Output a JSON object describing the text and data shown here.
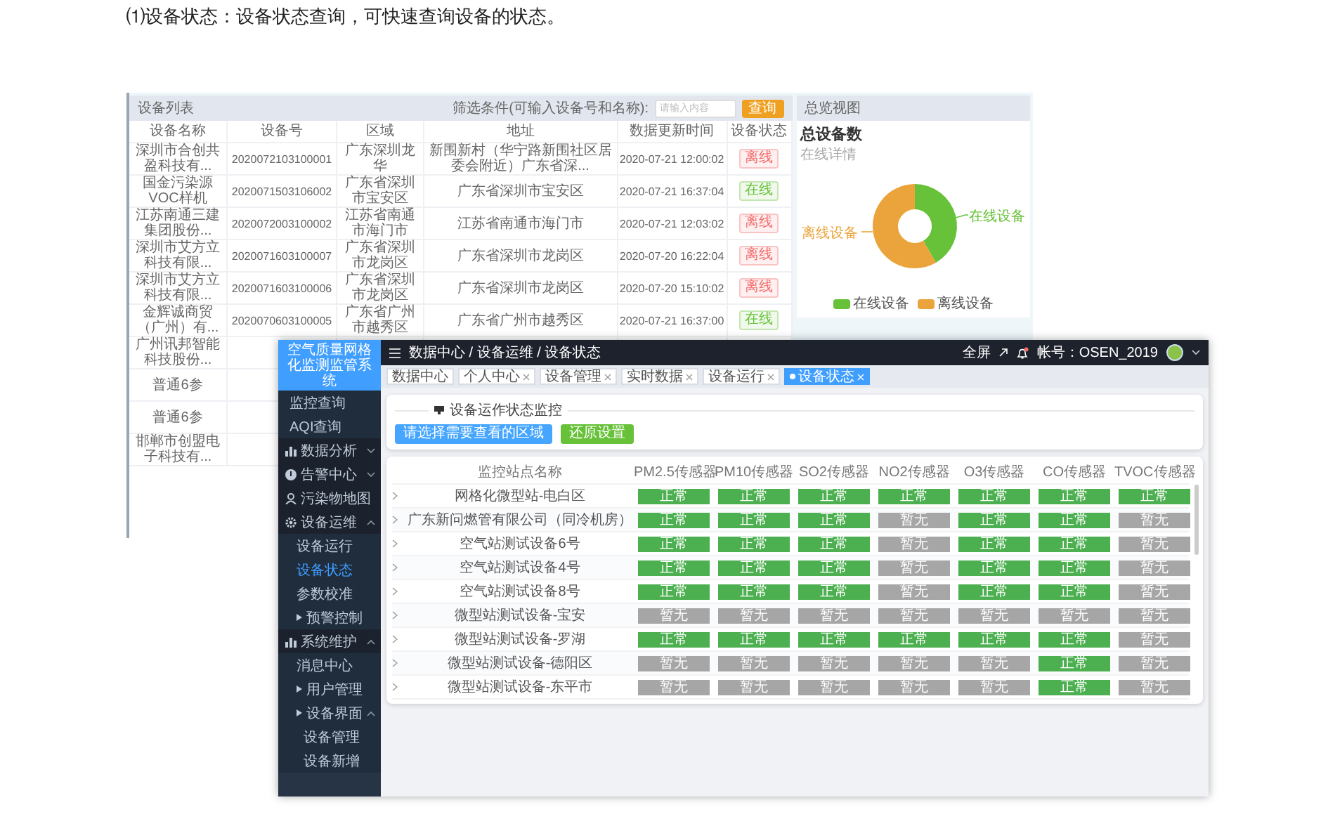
{
  "caption": "⑴设备状态：设备状态查询，可快速查询设备的状态。",
  "back_window": {
    "list_panel": {
      "title": "设备列表",
      "filter_label": "筛选条件(可输入设备号和名称):",
      "search": {
        "placeholder": "请输入内容"
      },
      "query_button": "查询",
      "columns": [
        "设备名称",
        "设备号",
        "区域",
        "地址",
        "数据更新时间",
        "设备状态"
      ],
      "rows": [
        {
          "name": "深圳市合创共盈科技有...",
          "number": "2020072103100001",
          "region": "广东深圳龙华",
          "address": "新围新村（华宁路新围社区居委会附近）广东省深...",
          "updated": "2020-07-21 12:00:02",
          "status": {
            "label": "离线",
            "online": false
          }
        },
        {
          "name": "国金污染源VOC样机",
          "number": "2020071503106002",
          "region": "广东省深圳市宝安区",
          "address": "广东省深圳市宝安区",
          "updated": "2020-07-21 16:37:04",
          "status": {
            "label": "在线",
            "online": true
          }
        },
        {
          "name": "江苏南通三建集团股份...",
          "number": "2020072003100002",
          "region": "江苏省南通市海门市",
          "address": "江苏省南通市海门市",
          "updated": "2020-07-21 12:03:02",
          "status": {
            "label": "离线",
            "online": false
          }
        },
        {
          "name": "深圳市艾方立科技有限...",
          "number": "2020071603100007",
          "region": "广东省深圳市龙岗区",
          "address": "广东省深圳市龙岗区",
          "updated": "2020-07-20 16:22:04",
          "status": {
            "label": "离线",
            "online": false
          }
        },
        {
          "name": "深圳市艾方立科技有限...",
          "number": "2020071603100006",
          "region": "广东省深圳市龙岗区",
          "address": "广东省深圳市龙岗区",
          "updated": "2020-07-20 15:10:02",
          "status": {
            "label": "离线",
            "online": false
          }
        },
        {
          "name": "金辉诚商贸（广州）有...",
          "number": "2020070603100005",
          "region": "广东省广州市越秀区",
          "address": "广东省广州市越秀区",
          "updated": "2020-07-21 16:37:00",
          "status": {
            "label": "在线",
            "online": true
          }
        }
      ],
      "partly_hidden_rows": [
        {
          "name": "广州讯邦智能科技股份..."
        },
        {
          "name": "普通6参"
        },
        {
          "name": "普通6参"
        },
        {
          "name": "邯郸市创盟电子科技有..."
        }
      ]
    },
    "overview_panel": {
      "title": "总览视图",
      "chart_title": "总设备数",
      "chart_subtitle": "在线详情",
      "slices": [
        {
          "label": "在线设备",
          "color": "#67c23a"
        },
        {
          "label": "离线设备",
          "color": "#eba43b"
        }
      ],
      "legend": [
        {
          "label": "在线设备",
          "color": "#67c23a"
        },
        {
          "label": "离线设备",
          "color": "#eba43b"
        }
      ]
    }
  },
  "front_window": {
    "sidebar": {
      "title": "空气质量网格化监测监管系统",
      "items": [
        {
          "kind": "link",
          "label": "监控查询",
          "selected": false
        },
        {
          "kind": "link",
          "label": "AQI查询",
          "selected": false
        },
        {
          "kind": "group",
          "label": "数据分析",
          "expanded": false
        },
        {
          "kind": "group",
          "label": "告警中心",
          "expanded": false
        },
        {
          "kind": "page",
          "label": "污染物地图"
        },
        {
          "kind": "group",
          "label": "设备运维",
          "expanded": true,
          "children": [
            {
              "kind": "link",
              "label": "设备运行",
              "selected": false
            },
            {
              "kind": "link",
              "label": "设备状态",
              "selected": true
            },
            {
              "kind": "link",
              "label": "参数校准",
              "selected": false
            },
            {
              "kind": "branch",
              "label": "预警控制",
              "expanded": false
            }
          ]
        },
        {
          "kind": "group",
          "label": "系统维护",
          "expanded": true,
          "children": [
            {
              "kind": "link",
              "label": "消息中心",
              "selected": false
            },
            {
              "kind": "branch",
              "label": "用户管理",
              "expanded": false
            },
            {
              "kind": "branch",
              "label": "设备界面",
              "expanded": true,
              "children": [
                {
                  "kind": "link",
                  "label": "设备管理",
                  "selected": false
                },
                {
                  "kind": "link",
                  "label": "设备新增",
                  "selected": false
                }
              ]
            }
          ]
        }
      ]
    },
    "top_bar": {
      "breadcrumb": "数据中心 / 设备运维 / 设备状态",
      "fullscreen": "全屏",
      "notification_dot": true,
      "account": "帐号：OSEN_2019"
    },
    "tabs": [
      {
        "label": "数据中心",
        "closable": false,
        "selected": false
      },
      {
        "label": "个人中心",
        "closable": true,
        "selected": false
      },
      {
        "label": "设备管理",
        "closable": true,
        "selected": false
      },
      {
        "label": "实时数据",
        "closable": true,
        "selected": false
      },
      {
        "label": "设备运行",
        "closable": true,
        "selected": false
      },
      {
        "label": "设备状态",
        "closable": true,
        "selected": true
      }
    ],
    "monitor_card": {
      "title": "设备运作状态监控",
      "buttons": [
        {
          "label": "请选择需要查看的区域",
          "kind": "primary"
        },
        {
          "label": "还原设置",
          "kind": "success"
        }
      ]
    },
    "sensor_table": {
      "name_column": "监控站点名称",
      "sensor_columns": [
        "PM2.5传感器",
        "PM10传感器",
        "SO2传感器",
        "NO2传感器",
        "O3传感器",
        "CO传感器",
        "TVOC传感器"
      ],
      "rows": [
        {
          "name": "网格化微型站-电白区",
          "cells": [
            {
              "label": "正常",
              "normal": true
            },
            {
              "label": "正常",
              "normal": true
            },
            {
              "label": "正常",
              "normal": true
            },
            {
              "label": "正常",
              "normal": true
            },
            {
              "label": "正常",
              "normal": true
            },
            {
              "label": "正常",
              "normal": true
            },
            {
              "label": "正常",
              "normal": true
            }
          ]
        },
        {
          "name": "广东新问燃管有限公司（同冷机房）",
          "cells": [
            {
              "label": "正常",
              "normal": true
            },
            {
              "label": "正常",
              "normal": true
            },
            {
              "label": "正常",
              "normal": true
            },
            {
              "label": "暂无",
              "normal": false
            },
            {
              "label": "正常",
              "normal": true
            },
            {
              "label": "正常",
              "normal": true
            },
            {
              "label": "暂无",
              "normal": false
            }
          ]
        },
        {
          "name": "空气站测试设备6号",
          "cells": [
            {
              "label": "正常",
              "normal": true
            },
            {
              "label": "正常",
              "normal": true
            },
            {
              "label": "正常",
              "normal": true
            },
            {
              "label": "暂无",
              "normal": false
            },
            {
              "label": "正常",
              "normal": true
            },
            {
              "label": "正常",
              "normal": true
            },
            {
              "label": "暂无",
              "normal": false
            }
          ]
        },
        {
          "name": "空气站测试设备4号",
          "cells": [
            {
              "label": "正常",
              "normal": true
            },
            {
              "label": "正常",
              "normal": true
            },
            {
              "label": "正常",
              "normal": true
            },
            {
              "label": "暂无",
              "normal": false
            },
            {
              "label": "正常",
              "normal": true
            },
            {
              "label": "正常",
              "normal": true
            },
            {
              "label": "暂无",
              "normal": false
            }
          ]
        },
        {
          "name": "空气站测试设备8号",
          "cells": [
            {
              "label": "正常",
              "normal": true
            },
            {
              "label": "正常",
              "normal": true
            },
            {
              "label": "正常",
              "normal": true
            },
            {
              "label": "暂无",
              "normal": false
            },
            {
              "label": "正常",
              "normal": true
            },
            {
              "label": "正常",
              "normal": true
            },
            {
              "label": "暂无",
              "normal": false
            }
          ]
        },
        {
          "name": "微型站测试设备-宝安",
          "cells": [
            {
              "label": "暂无",
              "normal": false
            },
            {
              "label": "暂无",
              "normal": false
            },
            {
              "label": "暂无",
              "normal": false
            },
            {
              "label": "暂无",
              "normal": false
            },
            {
              "label": "暂无",
              "normal": false
            },
            {
              "label": "暂无",
              "normal": false
            },
            {
              "label": "暂无",
              "normal": false
            }
          ]
        },
        {
          "name": "微型站测试设备-罗湖",
          "cells": [
            {
              "label": "正常",
              "normal": true
            },
            {
              "label": "正常",
              "normal": true
            },
            {
              "label": "正常",
              "normal": true
            },
            {
              "label": "正常",
              "normal": true
            },
            {
              "label": "正常",
              "normal": true
            },
            {
              "label": "正常",
              "normal": true
            },
            {
              "label": "暂无",
              "normal": false
            }
          ]
        },
        {
          "name": "微型站测试设备-德阳区",
          "cells": [
            {
              "label": "暂无",
              "normal": false
            },
            {
              "label": "暂无",
              "normal": false
            },
            {
              "label": "暂无",
              "normal": false
            },
            {
              "label": "暂无",
              "normal": false
            },
            {
              "label": "暂无",
              "normal": false
            },
            {
              "label": "正常",
              "normal": true
            },
            {
              "label": "暂无",
              "normal": false
            }
          ]
        },
        {
          "name": "微型站测试设备-东平市",
          "cells": [
            {
              "label": "暂无",
              "normal": false
            },
            {
              "label": "暂无",
              "normal": false
            },
            {
              "label": "暂无",
              "normal": false
            },
            {
              "label": "暂无",
              "normal": false
            },
            {
              "label": "暂无",
              "normal": false
            },
            {
              "label": "正常",
              "normal": true
            },
            {
              "label": "暂无",
              "normal": false
            }
          ]
        }
      ]
    }
  }
}
